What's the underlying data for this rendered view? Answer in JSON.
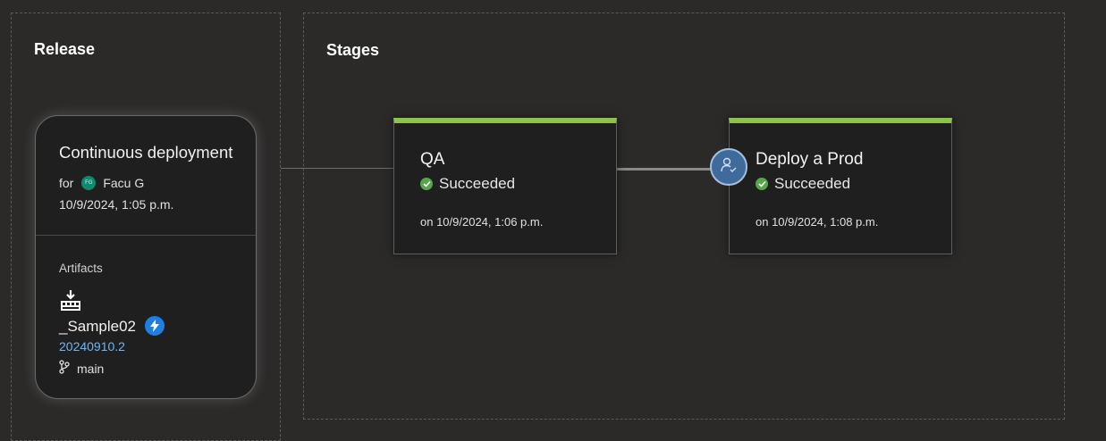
{
  "release": {
    "section_title": "Release",
    "card": {
      "title": "Continuous deployment",
      "for_label": "for",
      "user_initials": "FG",
      "user_name": "Facu G",
      "date": "10/9/2024, 1:05 p.m.",
      "artifacts_label": "Artifacts",
      "artifact_name": "_Sample02",
      "build_number": "20240910.2",
      "branch": "main"
    }
  },
  "stages": {
    "section_title": "Stages",
    "items": [
      {
        "name": "QA",
        "status": "Succeeded",
        "date": "on 10/9/2024, 1:06 p.m."
      },
      {
        "name": "Deploy a Prod",
        "status": "Succeeded",
        "date": "on 10/9/2024, 1:08 p.m."
      }
    ]
  },
  "colors": {
    "success": "#57a64a",
    "stage_bar": "#8dc34d",
    "link": "#6fb6f5",
    "approval": "#3f6a9c"
  },
  "icons": [
    "artifact-build-icon",
    "trigger-lightning-icon",
    "branch-icon",
    "check-circle-icon",
    "approval-person-icon"
  ]
}
